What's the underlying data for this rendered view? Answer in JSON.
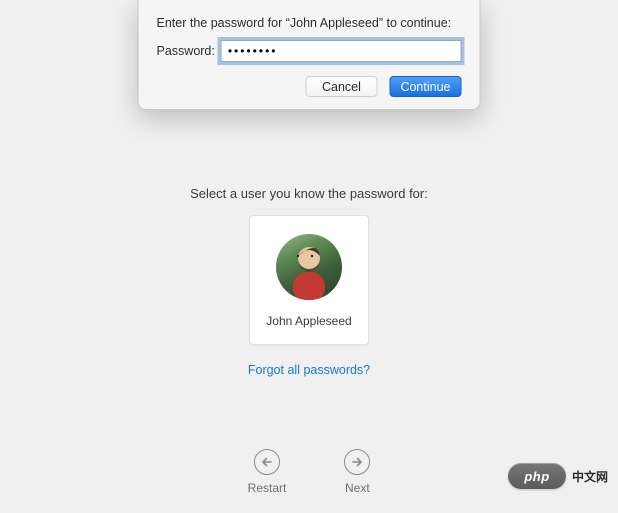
{
  "dialog": {
    "prompt": "Enter the password for “John Appleseed” to continue:",
    "password_label": "Password:",
    "password_value": "••••••••",
    "cancel_label": "Cancel",
    "continue_label": "Continue"
  },
  "selection": {
    "prompt": "Select a user you know the password for:",
    "user_name": "John Appleseed",
    "forgot_label": "Forgot all passwords?"
  },
  "nav": {
    "restart_label": "Restart",
    "next_label": "Next"
  },
  "watermark": {
    "logo_text": "php",
    "site_text": "中文网"
  }
}
